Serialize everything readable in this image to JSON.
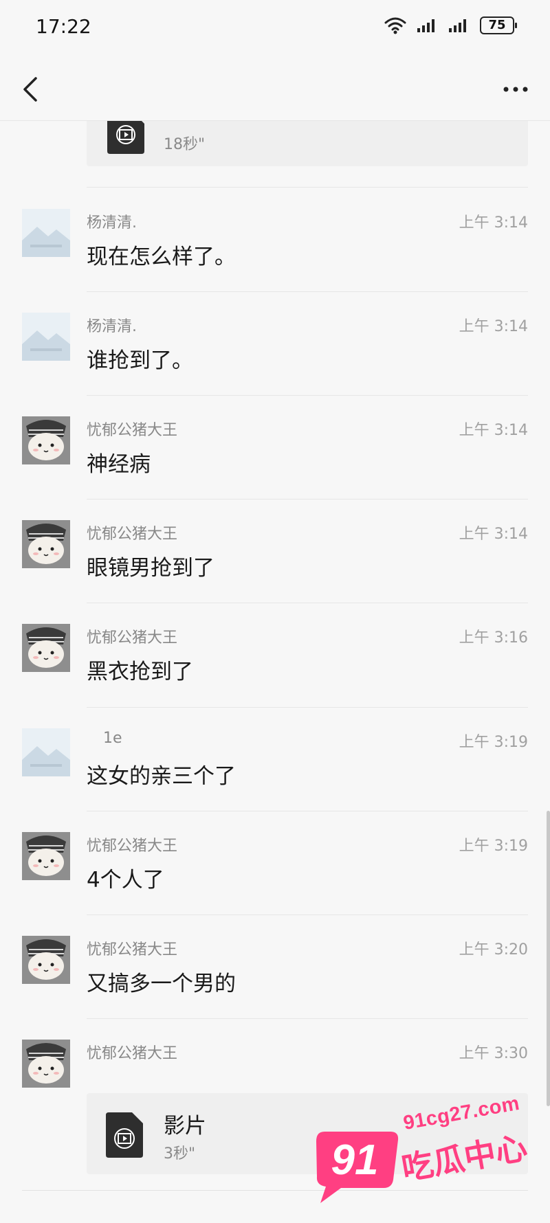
{
  "status_bar": {
    "time": "17:22",
    "battery": "75",
    "icons": [
      "wifi-icon",
      "signal-icon",
      "signal-icon",
      "battery-icon"
    ]
  },
  "nav": {
    "back_icon": "chevron-left-icon",
    "more_icon": "more-horizontal-icon"
  },
  "top_video": {
    "duration": "18秒\""
  },
  "messages": [
    {
      "sender": "杨清清.",
      "time": "上午 3:14",
      "text": "现在怎么样了。",
      "avatar": "landscape-placeholder"
    },
    {
      "sender": "杨清清.",
      "time": "上午 3:14",
      "text": "谁抢到了。",
      "avatar": "landscape-placeholder"
    },
    {
      "sender": "忧郁公猪大王",
      "time": "上午 3:14",
      "text": "神经病",
      "avatar": "cat-plush"
    },
    {
      "sender": "忧郁公猪大王",
      "time": "上午 3:14",
      "text": "眼镜男抢到了",
      "avatar": "cat-plush"
    },
    {
      "sender": "忧郁公猪大王",
      "time": "上午 3:16",
      "text": "黑衣抢到了",
      "avatar": "cat-plush"
    },
    {
      "sender": "1e",
      "time": "上午 3:19",
      "text": "这女的亲三个了",
      "avatar": "landscape-placeholder"
    },
    {
      "sender": "忧郁公猪大王",
      "time": "上午 3:19",
      "text": "4个人了",
      "avatar": "cat-plush"
    },
    {
      "sender": "忧郁公猪大王",
      "time": "上午 3:20",
      "text": "又搞多一个男的",
      "avatar": "cat-plush"
    },
    {
      "sender": "忧郁公猪大王",
      "time": "上午 3:30",
      "avatar": "cat-plush",
      "video": {
        "title": "影片",
        "duration": "3秒\""
      }
    }
  ],
  "watermark": {
    "badge": "91",
    "url": "91cg27.com",
    "name": "吃瓜中心"
  },
  "colors": {
    "background": "#f7f7f7",
    "card": "#efefef",
    "watermark": "#ff3f82"
  }
}
